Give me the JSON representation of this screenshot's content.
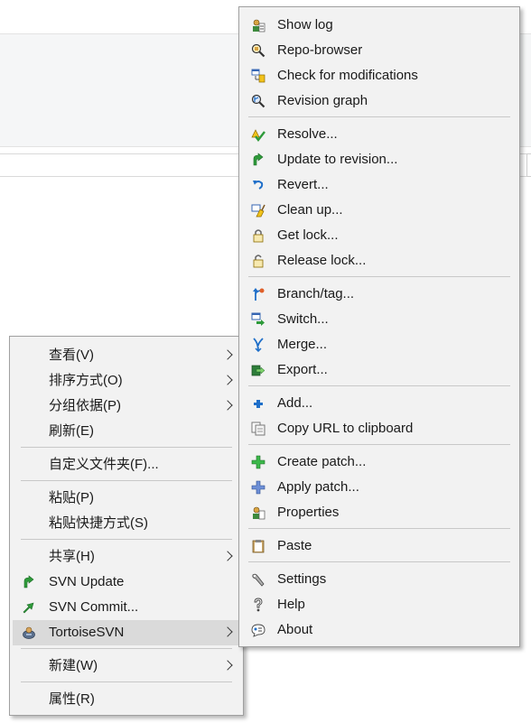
{
  "context_menu": {
    "view": "查看(V)",
    "sort_by": "排序方式(O)",
    "group_by": "分组依据(P)",
    "refresh": "刷新(E)",
    "customize_folder": "自定义文件夹(F)...",
    "paste": "粘贴(P)",
    "paste_shortcut": "粘贴快捷方式(S)",
    "share": "共享(H)",
    "svn_update": "SVN Update",
    "svn_commit": "SVN Commit...",
    "tortoisesvn": "TortoiseSVN",
    "new": "新建(W)",
    "properties": "属性(R)"
  },
  "svn_menu": {
    "show_log": "Show log",
    "repo_browser": "Repo-browser",
    "check_modifications": "Check for modifications",
    "revision_graph": "Revision graph",
    "resolve": "Resolve...",
    "update_to_revision": "Update to revision...",
    "revert": "Revert...",
    "clean_up": "Clean up...",
    "get_lock": "Get lock...",
    "release_lock": "Release lock...",
    "branch_tag": "Branch/tag...",
    "switch": "Switch...",
    "merge": "Merge...",
    "export": "Export...",
    "add": "Add...",
    "copy_url": "Copy URL to clipboard",
    "create_patch": "Create patch...",
    "apply_patch": "Apply patch...",
    "properties": "Properties",
    "paste": "Paste",
    "settings": "Settings",
    "help": "Help",
    "about": "About"
  },
  "colors": {
    "menu_bg": "#f2f2f2",
    "highlight": "#dadada",
    "svn_green": "#2e9a3a",
    "svn_blue": "#1f6fc9"
  }
}
